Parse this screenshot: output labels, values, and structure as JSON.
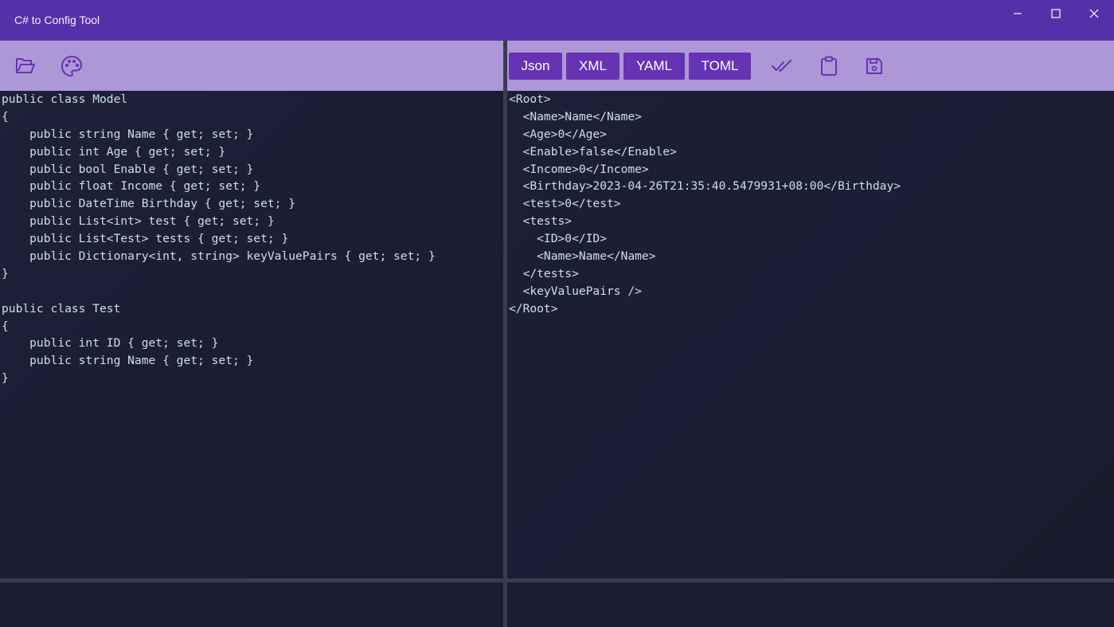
{
  "window": {
    "title": "C# to Config Tool"
  },
  "toolbar": {
    "left_icons": [
      "folder-open-icon",
      "palette-icon"
    ],
    "format_buttons": [
      "Json",
      "XML",
      "YAML",
      "TOML"
    ],
    "right_icons": [
      "double-check-icon",
      "clipboard-icon",
      "save-icon"
    ]
  },
  "colors": {
    "titlebar": "#5630a8",
    "toolbar": "#ae97d6",
    "button": "#6633b5",
    "editor_bg": "#1b1d33",
    "code_text": "#cbe0e4"
  },
  "source_code": [
    "public class Model",
    "{",
    "    public string Name { get; set; }",
    "    public int Age { get; set; }",
    "    public bool Enable { get; set; }",
    "    public float Income { get; set; }",
    "    public DateTime Birthday { get; set; }",
    "    public List<int> test { get; set; }",
    "    public List<Test> tests { get; set; }",
    "    public Dictionary<int, string> keyValuePairs { get; set; }",
    "}",
    "",
    "public class Test",
    "{",
    "    public int ID { get; set; }",
    "    public string Name { get; set; }",
    "}"
  ],
  "output_code": [
    "<Root>",
    "  <Name>Name</Name>",
    "  <Age>0</Age>",
    "  <Enable>false</Enable>",
    "  <Income>0</Income>",
    "  <Birthday>2023-04-26T21:35:40.5479931+08:00</Birthday>",
    "  <test>0</test>",
    "  <tests>",
    "    <ID>0</ID>",
    "    <Name>Name</Name>",
    "  </tests>",
    "  <keyValuePairs />",
    "</Root>"
  ]
}
